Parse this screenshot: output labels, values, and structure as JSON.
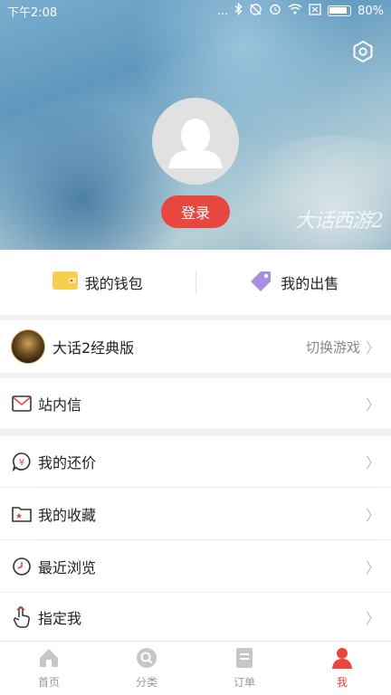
{
  "status_bar": {
    "time": "下午2:08",
    "dots": "...",
    "battery": "80%"
  },
  "header": {
    "login_label": "登录",
    "watermark": "大话西游2"
  },
  "wallet": {
    "my_wallet": "我的钱包",
    "my_sales": "我的出售"
  },
  "game": {
    "name": "大话2经典版",
    "switch_label": "切换游戏"
  },
  "menu": {
    "inbox": "站内信",
    "my_counteroffers": "我的还价",
    "my_favorites": "我的收藏",
    "recent": "最近浏览",
    "designate_me": "指定我"
  },
  "chevron": "〉",
  "tabs": [
    {
      "label": "首页",
      "icon": "home-icon"
    },
    {
      "label": "分类",
      "icon": "search-icon"
    },
    {
      "label": "订单",
      "icon": "order-icon"
    },
    {
      "label": "我",
      "icon": "user-icon",
      "active": true
    }
  ],
  "colors": {
    "accent": "#e8473f",
    "wallet_yellow": "#f6cf4f",
    "tag_purple": "#a98ee6"
  }
}
